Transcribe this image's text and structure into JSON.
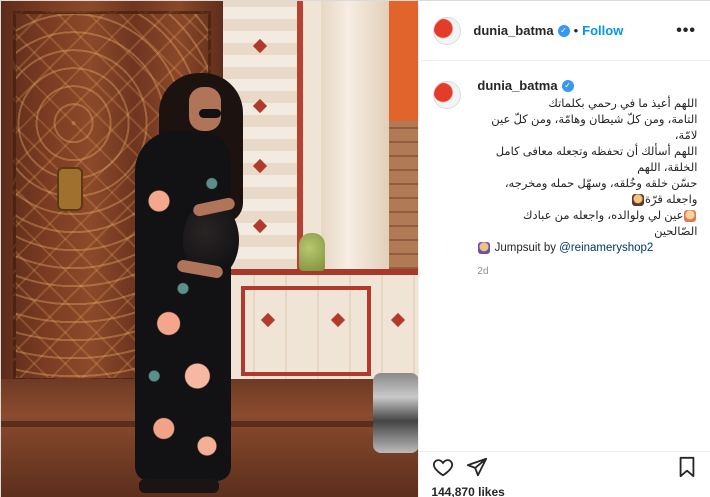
{
  "post": {
    "username": "dunia_batma",
    "follow_label": "Follow",
    "header_separator": "•",
    "more_label": "•••",
    "caption": {
      "username": "dunia_batma",
      "lines": [
        "اللهم أعيذ ما في رحمي بكلماتك",
        "التامة، ومن كلّ شيطان وهامّة، ومن كلّ عين لامّة،",
        "اللهم أسألك أن تحفظه وتجعله معافى كامل الخلقة، اللهم",
        "حسّن خلقه وخُلقه، وسهّل حمله ومخرجه، واجعله قرّة",
        "عين لي ولوالده، واجعله من عبادك الصّالحين"
      ],
      "jumpsuit_label": "Jumpsuit by",
      "jumpsuit_mention": "@reinameryshop2"
    },
    "time_ago": "2d",
    "likes": "144,870 likes"
  },
  "icons": {
    "verified": "verified-badge-icon",
    "like": "heart-icon",
    "share": "send-icon",
    "save": "bookmark-icon"
  },
  "colors": {
    "link": "#0095f6",
    "verified": "#3897f0",
    "mention": "#00376b",
    "muted": "#8e8e8e"
  }
}
